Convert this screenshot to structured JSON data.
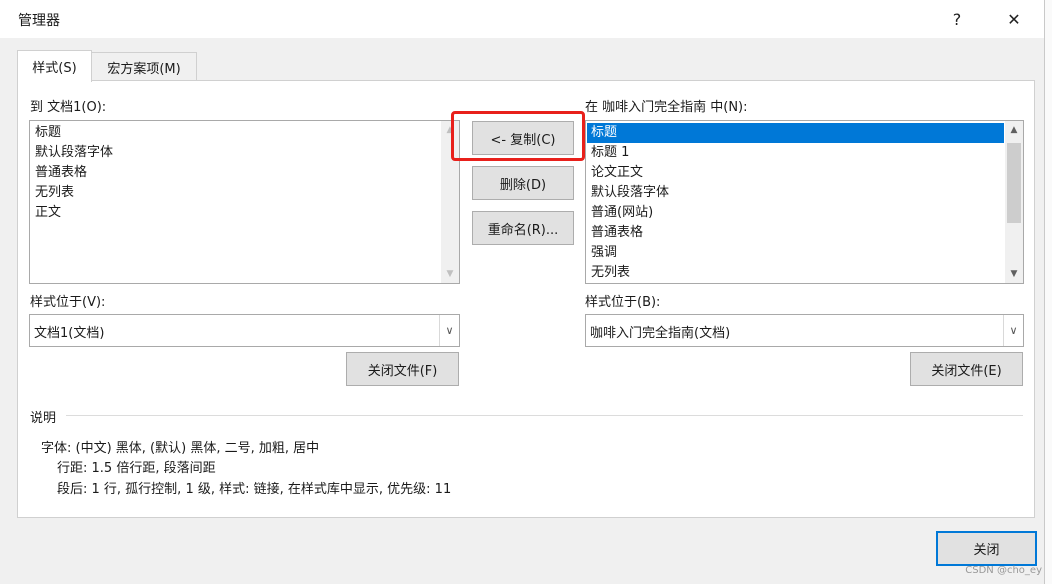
{
  "window": {
    "title": "管理器",
    "help_label": "?",
    "close_label": "✕"
  },
  "tabs": [
    {
      "label": "样式(S)",
      "mnemonic": "S",
      "active": true
    },
    {
      "label": "宏方案项(M)",
      "mnemonic": "M",
      "active": false
    }
  ],
  "left": {
    "list_label": "到 文档1(O):",
    "items": [
      "标题",
      "默认段落字体",
      "普通表格",
      "无列表",
      "正文"
    ],
    "location_label": "样式位于(V):",
    "location_value": "文档1(文档)",
    "close_file_label": "关闭文件(F)"
  },
  "right": {
    "list_label": "在 咖啡入门完全指南 中(N):",
    "items": [
      "标题",
      "标题 1",
      "论文正文",
      "默认段落字体",
      "普通(网站)",
      "普通表格",
      "强调",
      "无列表"
    ],
    "selected_index": 0,
    "location_label": "样式位于(B):",
    "location_value": "咖啡入门完全指南(文档)",
    "close_file_label": "关闭文件(E)"
  },
  "actions": {
    "copy_label": "<- 复制(C)",
    "delete_label": "删除(D)",
    "rename_label": "重命名(R)..."
  },
  "description": {
    "header": "说明",
    "lines": [
      "字体: (中文) 黑体, (默认) 黑体, 二号, 加粗, 居中",
      "行距: 1.5 倍行距, 段落间距",
      "段后: 1 行, 孤行控制, 1 级, 样式: 链接, 在样式库中显示, 优先级: 11"
    ]
  },
  "footer": {
    "close_label": "关闭"
  },
  "watermark": "CSDN @cho_ey",
  "icons": {
    "scroll_up": "▲",
    "scroll_down": "▼",
    "dropdown": "∨"
  },
  "colors": {
    "selection": "#0078d7",
    "highlight_box": "#e8201b"
  }
}
